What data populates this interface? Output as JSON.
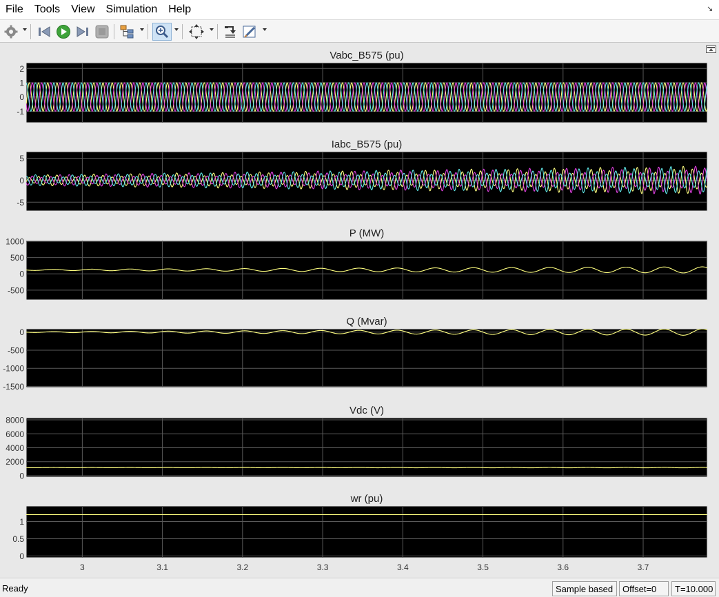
{
  "menu": {
    "items": [
      "File",
      "Tools",
      "View",
      "Simulation",
      "Help"
    ]
  },
  "toolbar": {
    "icons": [
      "settings-gear-icon",
      "step-back-icon",
      "run-icon",
      "step-forward-icon",
      "stop-icon",
      "signal-hierarchy-icon",
      "zoom-in-icon",
      "autoscale-icon",
      "restore-view-icon",
      "style-icon"
    ]
  },
  "colors": {
    "plot_bg": "#000000",
    "axes_frame": "#e0e0e0",
    "grid": "#5a5a5a",
    "phase_a": "#ffff80",
    "phase_b": "#e040e0",
    "phase_c": "#60e8e8",
    "scalar": "#ffff80",
    "tick_text": "#333333",
    "title_text": "#222222"
  },
  "chart_data": [
    {
      "type": "line",
      "title": "Vabc_B575 (pu)",
      "xlim": [
        2.93,
        3.78
      ],
      "ylim": [
        -1.8,
        2.4
      ],
      "yticks": [
        -1,
        0,
        1,
        2
      ],
      "grid": true,
      "series": [
        {
          "color": "#ffff80",
          "amplitude": 1.0,
          "offset": 0,
          "phase_deg": 0,
          "freq_hz": 60
        },
        {
          "color": "#e040e0",
          "amplitude": 1.0,
          "offset": 0,
          "phase_deg": -120,
          "freq_hz": 60
        },
        {
          "color": "#60e8e8",
          "amplitude": 1.0,
          "offset": 0,
          "phase_deg": 120,
          "freq_hz": 60
        }
      ]
    },
    {
      "type": "line",
      "title": "Iabc_B575 (pu)",
      "xlim": [
        2.93,
        3.78
      ],
      "ylim": [
        -7,
        6.5
      ],
      "yticks": [
        -5,
        0,
        5
      ],
      "grid": true,
      "series": [
        {
          "color": "#ffff80",
          "amplitude_start": 0.9,
          "amplitude_end": 2.4,
          "phase_deg": 0,
          "freq_hz": 60
        },
        {
          "color": "#e040e0",
          "amplitude_start": 0.9,
          "amplitude_end": 2.4,
          "phase_deg": -120,
          "freq_hz": 60
        },
        {
          "color": "#60e8e8",
          "amplitude_start": 0.9,
          "amplitude_end": 2.4,
          "phase_deg": 120,
          "freq_hz": 60
        }
      ]
    },
    {
      "type": "line",
      "title": "P (MW)",
      "xlim": [
        2.93,
        3.78
      ],
      "ylim": [
        -800,
        1020
      ],
      "yticks": [
        -500,
        0,
        500,
        1000
      ],
      "grid": true,
      "series": [
        {
          "color": "#ffff80",
          "offset": 120,
          "amplitude_start": 15,
          "amplitude_end": 95,
          "osc_hz": 21
        }
      ]
    },
    {
      "type": "line",
      "title": "Q (Mvar)",
      "xlim": [
        2.93,
        3.78
      ],
      "ylim": [
        -1530,
        90
      ],
      "yticks": [
        -1500,
        -1000,
        -500,
        0
      ],
      "grid": true,
      "series": [
        {
          "color": "#ffff80",
          "offset": 0,
          "amplitude_start": 10,
          "amplitude_end": 90,
          "osc_hz": 21
        }
      ]
    },
    {
      "type": "line",
      "title": "Vdc (V)",
      "xlim": [
        2.93,
        3.78
      ],
      "ylim": [
        -200,
        8300
      ],
      "yticks": [
        0,
        2000,
        4000,
        6000,
        8000
      ],
      "grid": true,
      "series": [
        {
          "color": "#ffff80",
          "offset": 1150,
          "amplitude_start": 10,
          "amplitude_end": 25,
          "osc_hz": 21
        }
      ]
    },
    {
      "type": "line",
      "title": "wr (pu)",
      "xlim": [
        2.93,
        3.78
      ],
      "ylim": [
        -0.05,
        1.45
      ],
      "yticks": [
        0,
        0.5,
        1
      ],
      "grid": true,
      "series": [
        {
          "color": "#ffff80",
          "offset": 1.2,
          "amplitude_start": 0,
          "amplitude_end": 0,
          "osc_hz": 0
        }
      ]
    }
  ],
  "x_axis": {
    "ticks": [
      3,
      3.1,
      3.2,
      3.3,
      3.4,
      3.5,
      3.6,
      3.7
    ],
    "tick_labels": [
      "3",
      "3.1",
      "3.2",
      "3.3",
      "3.4",
      "3.5",
      "3.6",
      "3.7"
    ]
  },
  "status": {
    "ready": "Ready",
    "sample_mode": "Sample based",
    "offset": "Offset=0",
    "time": "T=10.000"
  }
}
